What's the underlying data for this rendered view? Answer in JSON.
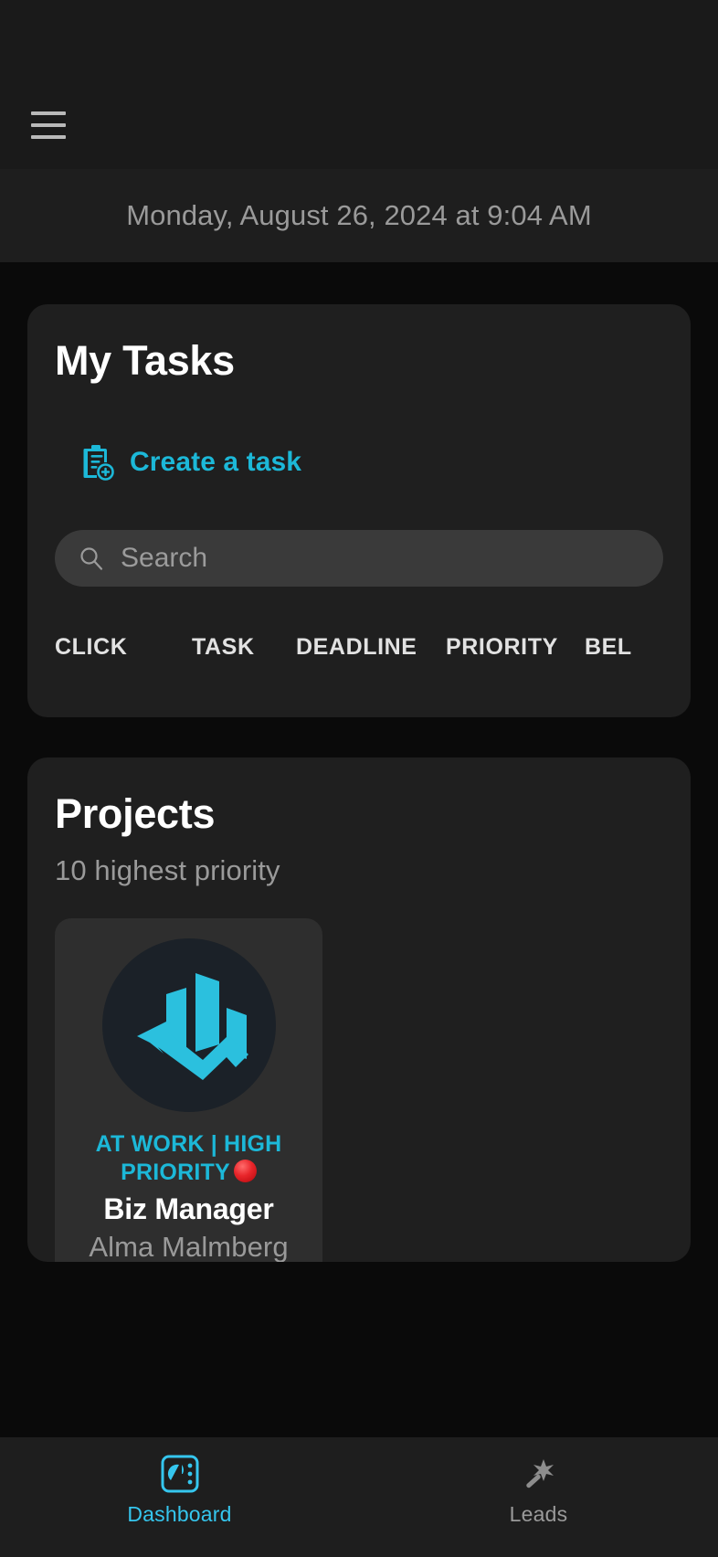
{
  "header": {
    "menu_icon": "hamburger-menu-icon",
    "datetime": "Monday, August 26, 2024 at 9:04 AM"
  },
  "tasks_card": {
    "title": "My Tasks",
    "create_task_label": "Create a task",
    "create_task_icon": "clipboard-add-icon",
    "search": {
      "icon": "search-icon",
      "placeholder": "Search",
      "value": ""
    },
    "columns": [
      "CLICK",
      "TASK",
      "DEADLINE",
      "PRIORITY",
      "BEL"
    ],
    "rows": []
  },
  "projects_card": {
    "title": "Projects",
    "subtitle": "10 highest priority",
    "projects": [
      {
        "logo_icon": "bar-chart-arrow-logo",
        "status": "AT WORK | HIGH PRIORITY",
        "status_emoji": "red-circle-emoji",
        "name": "Biz Manager",
        "owner": "Alma Malmberg"
      }
    ]
  },
  "tabbar": {
    "tabs": [
      {
        "label": "Dashboard",
        "icon": "dashboard-icon",
        "active": true
      },
      {
        "label": "Leads",
        "icon": "magic-wand-icon",
        "active": false
      }
    ]
  },
  "colors": {
    "accent": "#1cb8d8",
    "tab_active": "#35c6ee",
    "page_bg": "#0a0a0a",
    "card_bg": "#1f1f1f",
    "tile_bg": "#2e2e2e",
    "bar_bg": "#1a1a1a",
    "muted_text": "#9a9a9a",
    "priority_red": "#e8252a"
  }
}
